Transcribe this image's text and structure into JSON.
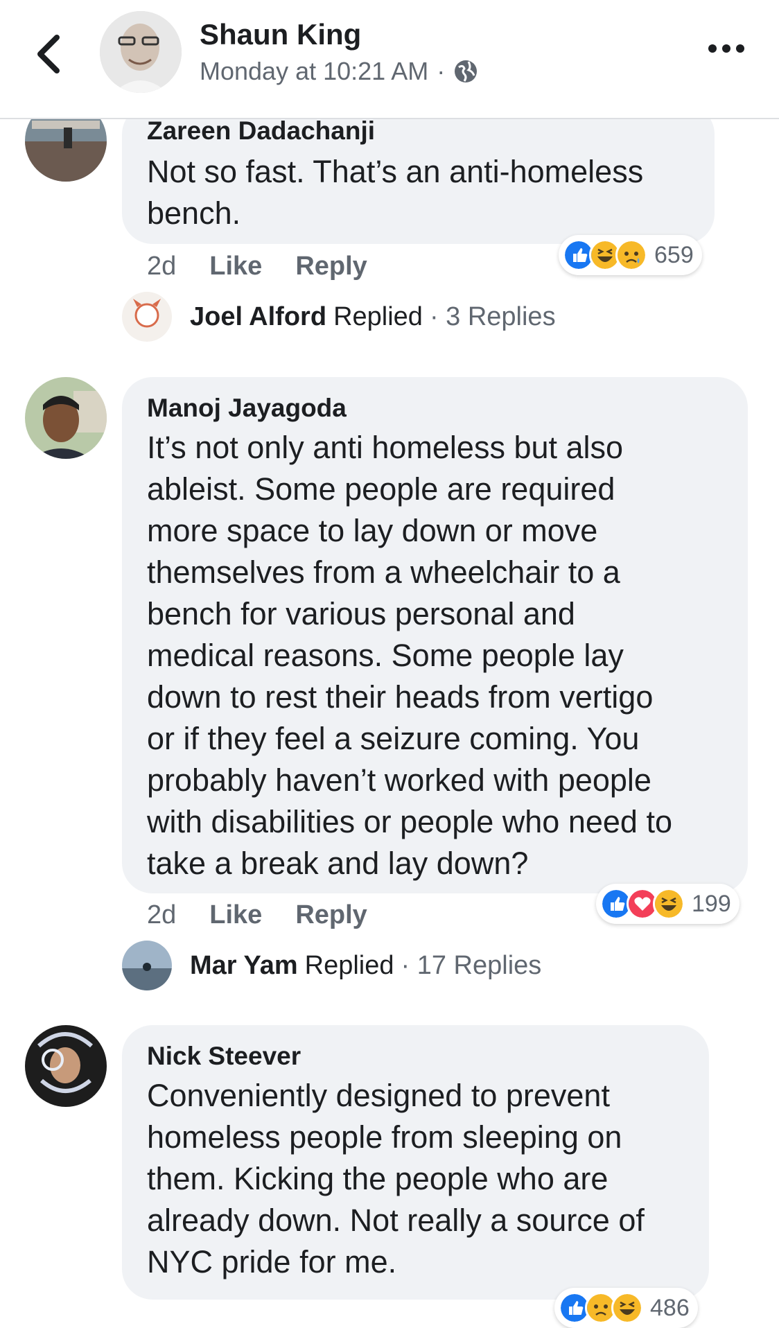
{
  "header": {
    "name": "Shaun King",
    "meta": "Monday at 10:21 AM",
    "separator": "·"
  },
  "comments": [
    {
      "author": "Zareen Dadachanji",
      "lines": [
        "Not so fast. That’s an anti-homeless",
        "bench."
      ],
      "time": "2d",
      "like": "Like",
      "reply": "Reply",
      "reaction_count": "659",
      "reactions": [
        "like-icon",
        "haha-icon",
        "sad-icon"
      ],
      "replied_by": "Joel Alford",
      "replied_verb": "Replied",
      "replies": "· 3 Replies"
    },
    {
      "author": "Manoj Jayagoda",
      "lines": [
        "It’s not only anti homeless but also",
        "ableist. Some people are required",
        "more space to lay down or move",
        "themselves from a wheelchair to a",
        "bench for various personal and",
        "medical reasons. Some people lay",
        "down to rest their heads from vertigo",
        "or if they feel a seizure coming. You",
        "probably haven’t worked with people",
        "with disabilities or people who need to",
        "take a break and lay down?"
      ],
      "time": "2d",
      "like": "Like",
      "reply": "Reply",
      "reaction_count": "199",
      "reactions": [
        "like-icon",
        "love-icon",
        "haha-icon"
      ],
      "replied_by": "Mar Yam",
      "replied_verb": "Replied",
      "replies": "· 17 Replies"
    },
    {
      "author": "Nick Steever",
      "lines": [
        "Conveniently designed to prevent",
        "homeless people from sleeping on",
        "them. Kicking the people who are",
        "already down. Not really a source of",
        "NYC pride for me."
      ],
      "reaction_count": "486",
      "reactions": [
        "like-icon",
        "sad-icon",
        "haha-icon"
      ]
    }
  ],
  "colors": {
    "like_blue": "#1877f2",
    "love_red": "#f33e58",
    "haha_yellow": "#f7b928",
    "bubble_gray": "#f0f2f5",
    "meta_gray": "#606770"
  }
}
